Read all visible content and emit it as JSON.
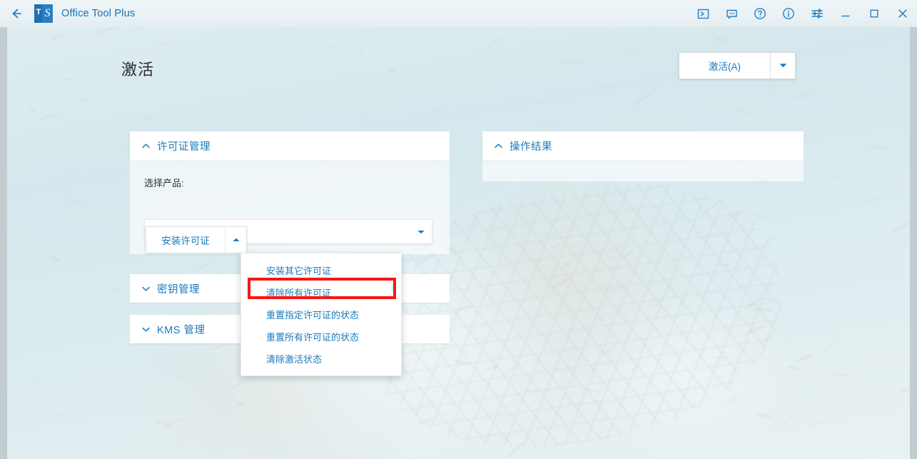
{
  "window": {
    "title": "Office Tool Plus",
    "back_icon": "arrow-left-icon",
    "logo_letter_primary": "T",
    "logo_letter_secondary": "S",
    "controls": [
      {
        "name": "console-icon",
        "glyph": "console"
      },
      {
        "name": "feedback-icon",
        "glyph": "comment"
      },
      {
        "name": "help-icon",
        "glyph": "question-circle"
      },
      {
        "name": "info-icon",
        "glyph": "info-circle"
      },
      {
        "name": "settings-icon",
        "glyph": "sliders"
      },
      {
        "name": "minimize-button",
        "glyph": "minimize"
      },
      {
        "name": "maximize-button",
        "glyph": "maximize"
      },
      {
        "name": "close-button",
        "glyph": "close"
      }
    ]
  },
  "page": {
    "title": "激活",
    "activate_button": {
      "label": "激活(A)",
      "dropdown_icon": "chevron-down-icon"
    }
  },
  "license_panel": {
    "title": "许可证管理",
    "collapse_icon": "chevron-up-icon",
    "product_label": "选择产品:",
    "product_value": "",
    "product_placeholder": "",
    "product_caret_icon": "chevron-down-icon",
    "install_button": {
      "label": "安装许可证",
      "dropdown_icon": "chevron-up-icon"
    }
  },
  "license_menu": {
    "items": [
      {
        "label": "安装其它许可证",
        "highlighted": false
      },
      {
        "label": "清除所有许可证",
        "highlighted": true
      },
      {
        "label": "重置指定许可证的状态",
        "highlighted": false
      },
      {
        "label": "重置所有许可证的状态",
        "highlighted": false
      },
      {
        "label": "清除激活状态",
        "highlighted": false
      }
    ]
  },
  "key_panel": {
    "title": "密钥管理",
    "expand_icon": "chevron-down-icon"
  },
  "kms_panel": {
    "title": "KMS 管理",
    "expand_icon": "chevron-down-icon"
  },
  "result_panel": {
    "title": "操作结果",
    "collapse_icon": "chevron-up-icon",
    "body_text": ""
  },
  "annotation": {
    "color": "#fc1414",
    "target": "清除所有许可证"
  },
  "colors": {
    "accent": "#1a7bbd",
    "titlebar_bg": "#eaf2f5",
    "window_chrome": "#c3cdd0",
    "card_bg": "#ffffff",
    "highlight": "#fc1414"
  }
}
